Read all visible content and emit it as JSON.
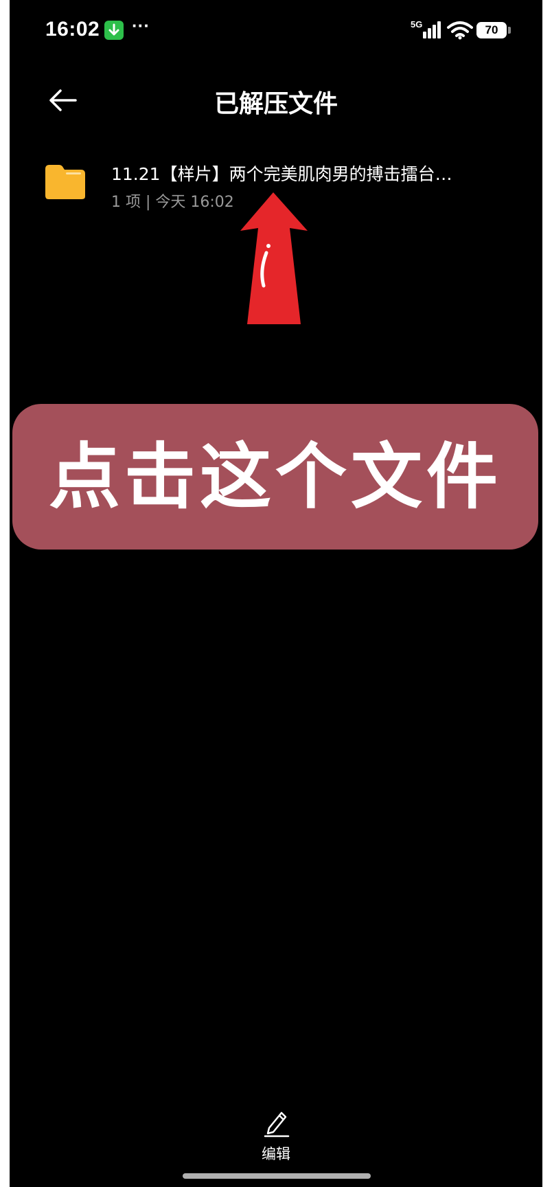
{
  "status_bar": {
    "time": "16:02",
    "more": "···",
    "network": "5G",
    "battery": "70",
    "icons": [
      "download-icon",
      "signal-icon",
      "wifi-icon",
      "battery-icon"
    ]
  },
  "header": {
    "title": "已解压文件",
    "back_icon": "arrow-left-icon"
  },
  "files": [
    {
      "name": "11.21【样片】两个完美肌肉男的搏击擂台…",
      "meta": "1 项 | 今天 16:02",
      "icon": "folder-icon"
    }
  ],
  "annotation": {
    "callout": "点击这个文件",
    "arrow_icon": "red-up-arrow-icon"
  },
  "bottom_bar": {
    "edit_label": "编辑",
    "edit_icon": "pencil-icon"
  },
  "colors": {
    "background": "#000000",
    "folder": "#f9b62e",
    "arrow": "#e5262a",
    "callout_bg": "#a4505a",
    "download_badge": "#2dbf4a"
  }
}
